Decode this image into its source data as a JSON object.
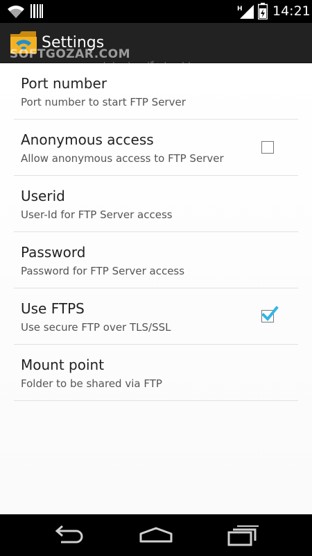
{
  "status_bar": {
    "time": "14:21",
    "icons": [
      "wifi-icon",
      "barcode-icon",
      "signal-icon",
      "battery-icon"
    ]
  },
  "action_bar": {
    "title": "Settings",
    "app_icon": "folder-wifi-icon",
    "watermark": "SOFTGOZAR.COM",
    "watermark_sub": "اولین دانشگاه مجازی ایران"
  },
  "preferences": [
    {
      "title": "Port number",
      "summary": "Port number to start FTP Server"
    },
    {
      "title": "Anonymous access",
      "summary": "Allow anonymous access to FTP Server",
      "checked": false
    },
    {
      "title": "Userid",
      "summary": "User-Id for FTP Server access"
    },
    {
      "title": "Password",
      "summary": "Password for FTP Server access"
    },
    {
      "title": "Use FTPS",
      "summary": "Use secure FTP over TLS/SSL",
      "checked": true
    },
    {
      "title": "Mount point",
      "summary": "Folder to be shared via FTP"
    }
  ],
  "nav_bar": {
    "buttons": [
      "back-icon",
      "home-icon",
      "recents-icon"
    ]
  },
  "colors": {
    "accent": "#33b5e5",
    "action_bar": "#222222",
    "status_bar": "#000000"
  }
}
